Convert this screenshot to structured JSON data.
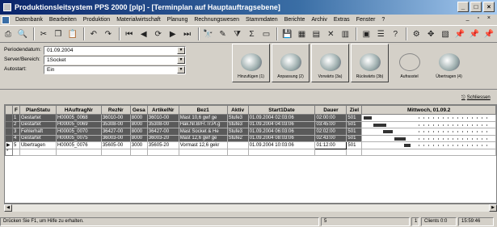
{
  "window": {
    "title": "Produktionsleitsystem PPS 2000 [plp] - [Terminplan auf Hauptauftragsebene]"
  },
  "menu": [
    "Datenbank",
    "Bearbeiten",
    "Produktion",
    "Materialwirtschaft",
    "Planung",
    "Rechnungswesen",
    "Stammdaten",
    "Berichte",
    "Archiv",
    "Extras",
    "Fenster",
    "?"
  ],
  "mdi_controls": "_ ▫ ×",
  "filters": {
    "periode_label": "Periodendatum:",
    "periode_value": "01.09.2004",
    "server_label": "Server/Bereich:",
    "server_value": "1Socket",
    "autostart_label": "Autostart:",
    "autostart_value": "Ein"
  },
  "actions": [
    "Hinzufügen (1)",
    "Anpassung (2)",
    "Vorwärts (3a)",
    "Rückwärts (3b)",
    "Aufrasstel",
    "Übertragen (4)"
  ],
  "close_label": "Schliessen",
  "grid": {
    "columns": [
      "F",
      "PlanStatu",
      "HAuftragNr",
      "RezNr",
      "Gesa",
      "ArtikelNr",
      "Bez1",
      "Aktiv",
      "Start1Date",
      "Dauer",
      "Ziel",
      "Mittwoch, 01.09.2"
    ],
    "rows": [
      {
        "n": "1",
        "status": "Gestartet",
        "auftrag": "H00005_0068",
        "rez": "36010-00",
        "gesa": "8000",
        "artikel": "36010-00",
        "bez": "Mast 10,6 gwf ge",
        "aktiv": "Stufe3",
        "start": "01.09.2004 02:03:06",
        "dauer": "02:00:00",
        "ziel": "501"
      },
      {
        "n": "2",
        "status": "Gestartet",
        "auftrag": "H00005_0069",
        "rez": "35308-00",
        "gesa": "8000",
        "artikel": "35308-00",
        "bez": "Hak.Nr.B/Fr.Tr.Pl.g",
        "aktiv": "Stufe3",
        "start": "01.09.2004 04:03:06",
        "dauer": "03:45:00",
        "ziel": "501"
      },
      {
        "n": "3",
        "status": "Fehlerhaft",
        "auftrag": "H00005_0070",
        "rez": "36427-00",
        "gesa": "8000",
        "artikel": "36427-00",
        "bez": "Mast Socket & He",
        "aktiv": "Stufe3",
        "start": "01.09.2004 06:03:06",
        "dauer": "02:02:00",
        "ziel": "501"
      },
      {
        "n": "4",
        "status": "Gestartet",
        "auftrag": "H00005_0075",
        "rez": "36003-00",
        "gesa": "8000",
        "artikel": "36003-20",
        "bez": "Mast 12,6 gwf ge",
        "aktiv": "Stufe2",
        "start": "01.09.2004 08:03:06",
        "dauer": "02:43:00",
        "ziel": "501"
      },
      {
        "n": "5",
        "status": "Übertragen",
        "auftrag": "H00005_0076",
        "rez": "35605-00",
        "gesa": "3000",
        "artikel": "35605-20",
        "bez": "Vormast 12,6 gekr",
        "aktiv": "",
        "start": "01.09.2004 10:03:06",
        "dauer": "01:12:00",
        "ziel": "501"
      }
    ],
    "new_row_marker": "*",
    "current_row_marker": "▶"
  },
  "status": {
    "help": "Drücken Sie F1, um Hilfe zu erhalten.",
    "count": "5",
    "sep": "1",
    "clients": "Clients 0:0",
    "time": "15:59:46"
  }
}
